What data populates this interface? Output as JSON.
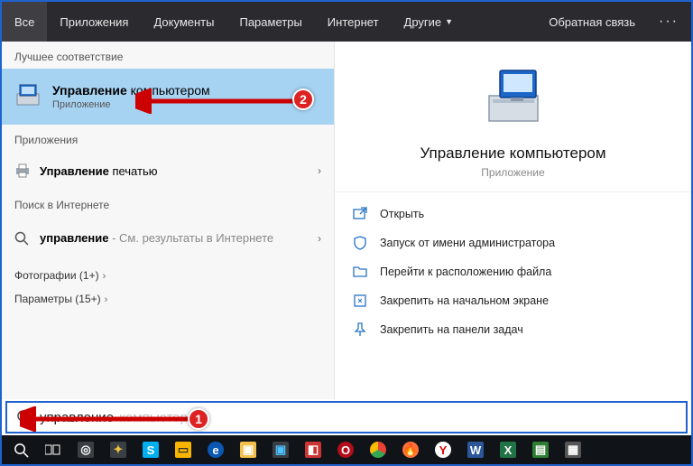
{
  "tabs": {
    "all": "Все",
    "apps": "Приложения",
    "docs": "Документы",
    "settings": "Параметры",
    "internet": "Интернет",
    "more": "Другие"
  },
  "feedback": "Обратная связь",
  "left": {
    "best_match_label": "Лучшее соответствие",
    "best": {
      "title_bold": "Управление",
      "title_rest": " компьютером",
      "sub": "Приложение"
    },
    "apps_label": "Приложения",
    "print": {
      "bold": "Управление",
      "rest": " печатью"
    },
    "web_label": "Поиск в Интернете",
    "web": {
      "bold": "управление",
      "rest": " - См. результаты в Интернете"
    },
    "photos": "Фотографии (1+)",
    "params": "Параметры (15+)"
  },
  "right": {
    "title": "Управление компьютером",
    "sub": "Приложение",
    "actions": {
      "open": "Открыть",
      "admin": "Запуск от имени администратора",
      "location": "Перейти к расположению файла",
      "pin_start": "Закрепить на начальном экране",
      "pin_task": "Закрепить на панели задач"
    }
  },
  "search": {
    "value": "управление",
    "ghost": " компьютером"
  },
  "annotations": {
    "b1": "1",
    "b2": "2"
  }
}
